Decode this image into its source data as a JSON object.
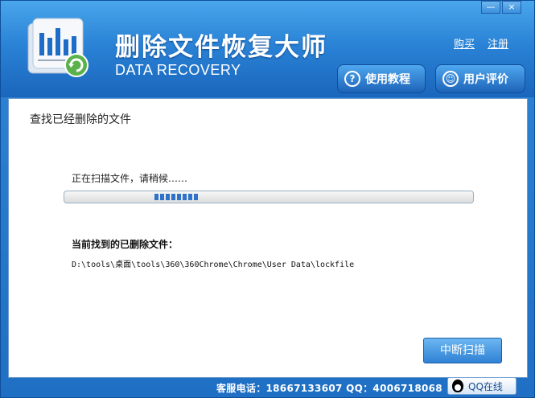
{
  "window": {
    "minimize_label": "—",
    "close_label": "×"
  },
  "header": {
    "title_cn": "删除文件恢复大师",
    "title_en": "DATA RECOVERY",
    "buy_link": "购买",
    "register_link": "注册",
    "tutorial_button": "使用教程",
    "review_button": "用户评价",
    "tutorial_icon": "question-circle-icon",
    "review_icon": "user-review-icon"
  },
  "main": {
    "heading": "查找已经删除的文件",
    "status_text": "正在扫描文件，请稍候……",
    "found_label": "当前找到的已删除文件：",
    "found_path": "D:\\tools\\桌面\\tools\\360\\360Chrome\\Chrome\\User Data\\lockfile",
    "stop_button": "中断扫描"
  },
  "footer": {
    "contact_text": "客服电话：18667133607  QQ：4006718068",
    "qq_label": "QQ在线"
  },
  "colors": {
    "banner_top": "#4aa6ec",
    "banner_bottom": "#1a66bd",
    "progress": "#2e72c9"
  }
}
